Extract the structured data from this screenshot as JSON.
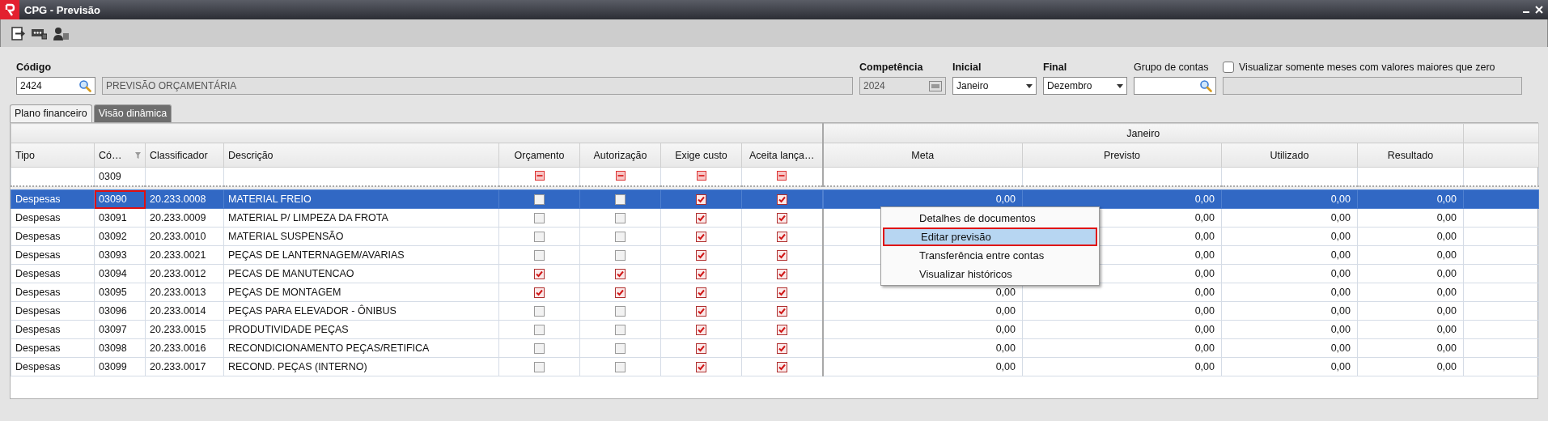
{
  "window": {
    "title": "CPG - Previsão"
  },
  "form": {
    "codigo": {
      "label": "Código",
      "value": "2424"
    },
    "descricao": {
      "value": "PREVISÃO ORÇAMENTÁRIA"
    },
    "competencia": {
      "label": "Competência",
      "value": "2024"
    },
    "inicial": {
      "label": "Inicial",
      "value": "Janeiro"
    },
    "final": {
      "label": "Final",
      "value": "Dezembro"
    },
    "grupo": {
      "label": "Grupo de contas"
    },
    "only_nonzero": {
      "label": "Visualizar somente meses com valores maiores que zero",
      "checked": false
    }
  },
  "tabs": [
    {
      "label": "Plano financeiro",
      "selected": true
    },
    {
      "label": "Visão dinâmica",
      "selected": false
    }
  ],
  "table": {
    "group_header": "Janeiro",
    "columns": [
      "Tipo",
      "Có…",
      "Classificador",
      "Descrição",
      "Orçamento",
      "Autorização",
      "Exige custo",
      "Aceita lança…",
      "Meta",
      "Previsto",
      "Utilizado",
      "Resultado"
    ],
    "filter": {
      "code": "0309"
    },
    "rows": [
      {
        "tipo": "Despesas",
        "codigo": "03090",
        "code_outlined": true,
        "classificador": "20.233.0008",
        "descricao": "MATERIAL FREIO",
        "orcamento": false,
        "autorizacao": false,
        "exige_custo": true,
        "aceita_lancamento": true,
        "meta": "0,00",
        "previsto": "0,00",
        "utilizado": "0,00",
        "resultado": "0,00",
        "selected": true
      },
      {
        "tipo": "Despesas",
        "codigo": "03091",
        "code_outlined": false,
        "classificador": "20.233.0009",
        "descricao": "MATERIAL P/ LIMPEZA DA FROTA",
        "orcamento": false,
        "autorizacao": false,
        "exige_custo": true,
        "aceita_lancamento": true,
        "previsto": "0,00",
        "utilizado": "0,00",
        "resultado": "0,00",
        "selected": false
      },
      {
        "tipo": "Despesas",
        "codigo": "03092",
        "code_outlined": false,
        "classificador": "20.233.0010",
        "descricao": "MATERIAL SUSPENSÃO",
        "orcamento": false,
        "autorizacao": false,
        "exige_custo": true,
        "aceita_lancamento": true,
        "previsto": "0,00",
        "utilizado": "0,00",
        "resultado": "0,00",
        "selected": false
      },
      {
        "tipo": "Despesas",
        "codigo": "03093",
        "code_outlined": false,
        "classificador": "20.233.0021",
        "descricao": "PEÇAS DE LANTERNAGEM/AVARIAS",
        "orcamento": false,
        "autorizacao": false,
        "exige_custo": true,
        "aceita_lancamento": true,
        "previsto": "0,00",
        "utilizado": "0,00",
        "resultado": "0,00",
        "selected": false
      },
      {
        "tipo": "Despesas",
        "codigo": "03094",
        "code_outlined": false,
        "classificador": "20.233.0012",
        "descricao": "PECAS DE MANUTENCAO",
        "orcamento": true,
        "autorizacao": true,
        "exige_custo": true,
        "aceita_lancamento": true,
        "previsto": "0,00",
        "utilizado": "0,00",
        "resultado": "0,00",
        "selected": false
      },
      {
        "tipo": "Despesas",
        "codigo": "03095",
        "code_outlined": false,
        "classificador": "20.233.0013",
        "descricao": "PEÇAS DE MONTAGEM",
        "orcamento": true,
        "autorizacao": true,
        "exige_custo": true,
        "aceita_lancamento": true,
        "meta": "0,00",
        "previsto": "0,00",
        "utilizado": "0,00",
        "resultado": "0,00",
        "selected": false
      },
      {
        "tipo": "Despesas",
        "codigo": "03096",
        "code_outlined": false,
        "classificador": "20.233.0014",
        "descricao": "PEÇAS PARA ELEVADOR - ÔNIBUS",
        "orcamento": false,
        "autorizacao": false,
        "exige_custo": true,
        "aceita_lancamento": true,
        "meta": "0,00",
        "previsto": "0,00",
        "utilizado": "0,00",
        "resultado": "0,00",
        "selected": false
      },
      {
        "tipo": "Despesas",
        "codigo": "03097",
        "code_outlined": false,
        "classificador": "20.233.0015",
        "descricao": "PRODUTIVIDADE PEÇAS",
        "orcamento": false,
        "autorizacao": false,
        "exige_custo": true,
        "aceita_lancamento": true,
        "meta": "0,00",
        "previsto": "0,00",
        "utilizado": "0,00",
        "resultado": "0,00",
        "selected": false
      },
      {
        "tipo": "Despesas",
        "codigo": "03098",
        "code_outlined": false,
        "classificador": "20.233.0016",
        "descricao": "RECONDICIONAMENTO PEÇAS/RETIFICA",
        "orcamento": false,
        "autorizacao": false,
        "exige_custo": true,
        "aceita_lancamento": true,
        "meta": "0,00",
        "previsto": "0,00",
        "utilizado": "0,00",
        "resultado": "0,00",
        "selected": false
      },
      {
        "tipo": "Despesas",
        "codigo": "03099",
        "code_outlined": false,
        "classificador": "20.233.0017",
        "descricao": "RECOND. PEÇAS (INTERNO)",
        "orcamento": false,
        "autorizacao": false,
        "exige_custo": true,
        "aceita_lancamento": true,
        "meta": "0,00",
        "previsto": "0,00",
        "utilizado": "0,00",
        "resultado": "0,00",
        "selected": false
      }
    ]
  },
  "context_menu": {
    "items": [
      {
        "label": "Detalhes de documentos",
        "selected": false,
        "outlined": false
      },
      {
        "label": "Editar previsão",
        "selected": true,
        "outlined": true
      },
      {
        "label": "Transferência entre contas",
        "selected": false,
        "outlined": false
      },
      {
        "label": "Visualizar históricos",
        "selected": false,
        "outlined": false
      }
    ]
  }
}
